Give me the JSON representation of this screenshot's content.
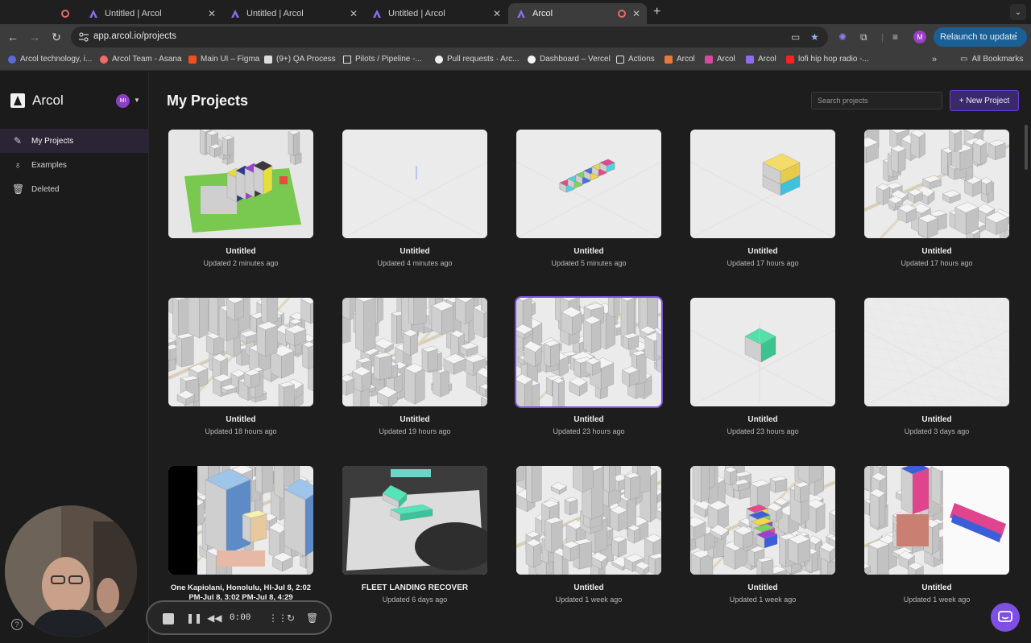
{
  "browser": {
    "tabs": [
      {
        "label": "",
        "icon": "record-icon"
      },
      {
        "label": "Untitled | Arcol",
        "icon": "arcol-icon"
      },
      {
        "label": "Untitled | Arcol",
        "icon": "arcol-icon"
      },
      {
        "label": "Untitled | Arcol",
        "icon": "arcol-icon"
      },
      {
        "label": "Arcol",
        "icon": "arcol-icon",
        "active": true
      }
    ],
    "url": "app.arcol.io/projects",
    "profile_initial": "M",
    "relaunch_label": "Relaunch to update",
    "bookmarks": [
      "Arcol technology, i...",
      "Arcol Team - Asana",
      "Main UI – Figma",
      "(9+) QA Process",
      "Pilots / Pipeline -...",
      "Pull requests · Arc...",
      "Dashboard – Vercel",
      "Actions",
      "Arcol",
      "Arcol",
      "Arcol",
      "lofi hip hop radio -..."
    ],
    "all_bookmarks": "All Bookmarks"
  },
  "sidebar": {
    "brand": "Arcol",
    "user_initials": "MI",
    "items": [
      {
        "label": "My Projects",
        "icon": "pencil-icon"
      },
      {
        "label": "Examples",
        "icon": "bulb-icon"
      },
      {
        "label": "Deleted",
        "icon": "trash-icon"
      }
    ],
    "help": "?"
  },
  "main": {
    "title": "My Projects",
    "search_placeholder": "Search projects",
    "new_project_label": "+ New Project"
  },
  "projects": [
    {
      "name": "Untitled",
      "updated": "Updated 2 minutes ago",
      "thumb": "site-plan"
    },
    {
      "name": "Untitled",
      "updated": "Updated 4 minutes ago",
      "thumb": "empty"
    },
    {
      "name": "Untitled",
      "updated": "Updated 5 minutes ago",
      "thumb": "color-block"
    },
    {
      "name": "Untitled",
      "updated": "Updated 17 hours ago",
      "thumb": "yellow-block"
    },
    {
      "name": "Untitled",
      "updated": "Updated 17 hours ago",
      "thumb": "city-small"
    },
    {
      "name": "Untitled",
      "updated": "Updated 18 hours ago",
      "thumb": "city-close"
    },
    {
      "name": "Untitled",
      "updated": "Updated 19 hours ago",
      "thumb": "city"
    },
    {
      "name": "Untitled",
      "updated": "Updated 23 hours ago",
      "thumb": "city",
      "selected": true
    },
    {
      "name": "Untitled",
      "updated": "Updated 23 hours ago",
      "thumb": "green-cube"
    },
    {
      "name": "Untitled",
      "updated": "Updated 3 days ago",
      "thumb": "empty-grid"
    },
    {
      "name": "One Kapiolani, Honolulu, HI-Jul 8, 2:02 PM-Jul 8, 3:02 PM-Jul 8, 4:29",
      "updated": "",
      "thumb": "tower"
    },
    {
      "name": "FLEET LANDING RECOVER",
      "updated": "Updated 6 days ago",
      "thumb": "campus"
    },
    {
      "name": "Untitled",
      "updated": "Updated 1 week ago",
      "thumb": "city"
    },
    {
      "name": "Untitled",
      "updated": "Updated 1 week ago",
      "thumb": "city-color"
    },
    {
      "name": "Untitled",
      "updated": "Updated 1 week ago",
      "thumb": "split"
    }
  ],
  "recorder": {
    "time": "0:00"
  },
  "colors": {
    "accent": "#7b4fe0",
    "bg": "#1d1d1d",
    "sidebar_active": "#2a2435"
  }
}
